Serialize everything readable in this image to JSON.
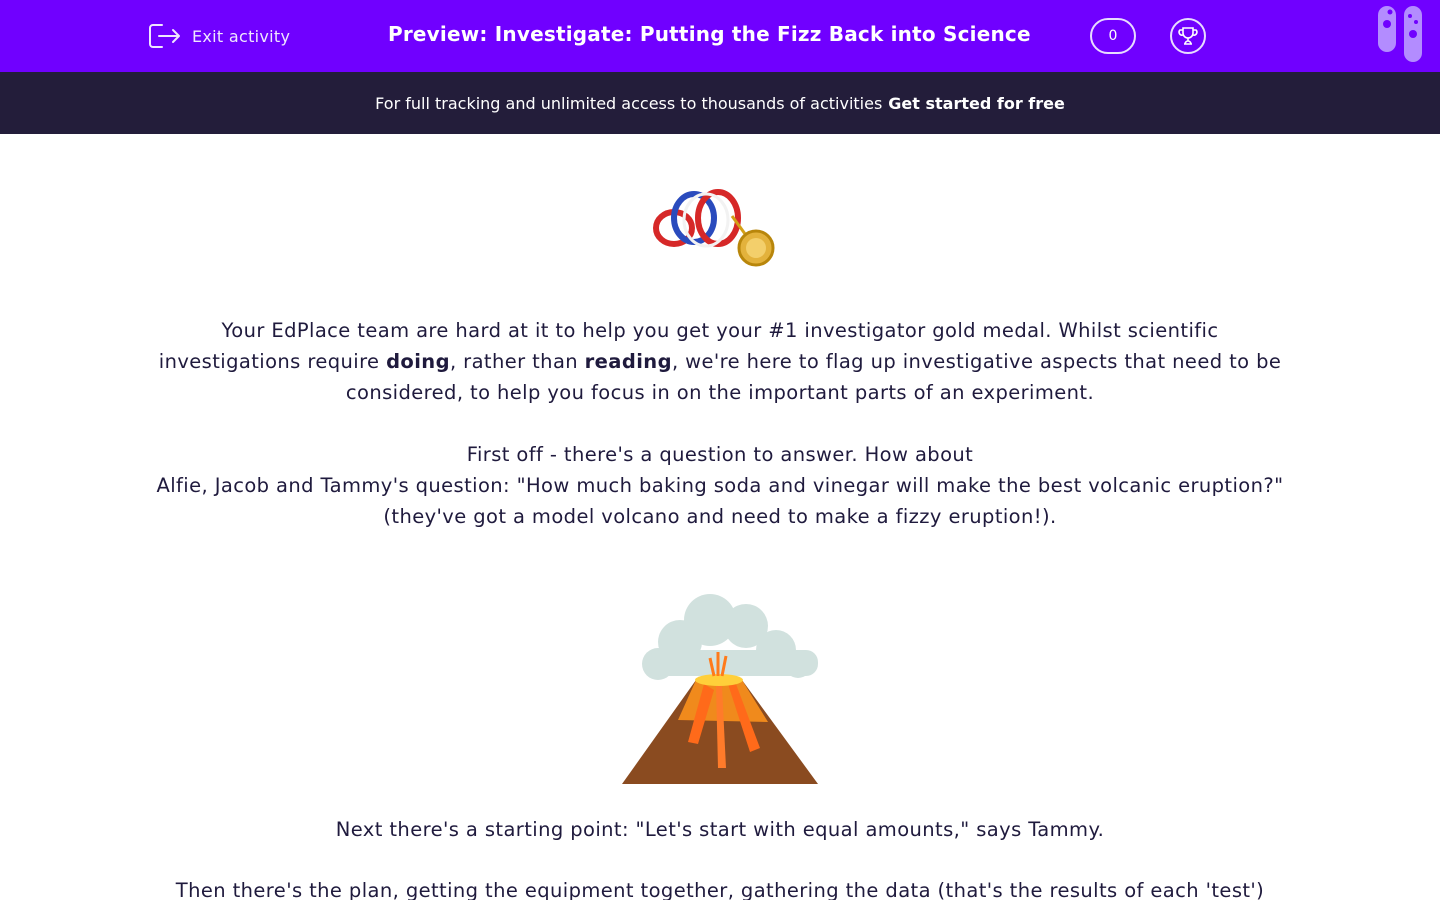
{
  "header": {
    "exit_label": "Exit activity",
    "title": "Preview: Investigate: Putting the Fizz Back into Science",
    "score": "0",
    "trophy_icon": "trophy-icon",
    "accent": "#7000ff"
  },
  "banner": {
    "text": "For full tracking and unlimited access to thousands of activities",
    "cta": "Get started for free",
    "background": "#231d3a"
  },
  "content": {
    "para1_before": "Your EdPlace team are hard at it to help you get your #1 investigator gold medal. Whilst scientific investigations require ",
    "para1_bold1": "doing",
    "para1_mid": ", rather than ",
    "para1_bold2": "reading",
    "para1_after": ", we're here to flag up investigative aspects that need to be considered, to help you focus in on the important parts of an experiment.",
    "para2_line1": "First off - there's a question to answer. How about",
    "para2_line2": "Alfie, Jacob and Tammy's question: \"How much baking soda and vinegar will make the best volcanic eruption?\" (they've got a model volcano and need to make a fizzy eruption!).",
    "para3": "Next there's a starting point: \"Let's start with equal amounts,\" says Tammy.",
    "para4": "Then there's the plan, getting the equipment together, gathering the data (that's the results of each 'test')",
    "images": [
      "gold-medal-image",
      "volcano-image"
    ]
  }
}
